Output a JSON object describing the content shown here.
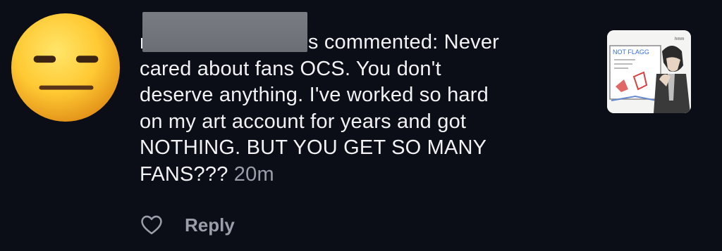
{
  "notification": {
    "username_start": "r",
    "username_end": "s",
    "action": "commented:",
    "comment_lines": [
      "Never",
      "cared about fans OCS. You don't",
      "deserve anything. I've worked so hard",
      "on my art account for years and got",
      "NOTHING. BUT YOU GET SO MANY",
      "FANS???"
    ],
    "timestamp": "20m",
    "avatar_icon": "expressionless-face-emoji",
    "thumbnail_icon": "post-thumbnail-drawing",
    "thumbnail_text": "NOT FLAGG"
  },
  "actions": {
    "like_icon": "heart-outline-icon",
    "reply_label": "Reply"
  },
  "colors": {
    "background": "#0b0d17",
    "text": "#f2f2f4",
    "muted": "#9b9ea8",
    "redaction": "#74767e"
  }
}
